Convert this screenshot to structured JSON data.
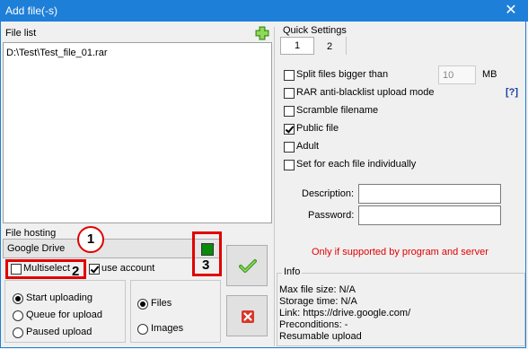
{
  "window": {
    "title": "Add file(-s)",
    "close_glyph": "✕"
  },
  "file_list": {
    "label": "File list",
    "add_icon": "plus-icon",
    "items": [
      "D:\\Test\\Test_file_01.rar"
    ]
  },
  "file_hosting": {
    "label": "File hosting",
    "selected": "Google Drive",
    "multiselect_label": "Multiselect",
    "multiselect_checked": false,
    "use_account_label": "use account",
    "use_account_checked": true,
    "status_color": "#0a8a0a"
  },
  "upload_mode": {
    "options": [
      "Start uploading",
      "Queue for upload",
      "Paused upload"
    ],
    "selected": 0
  },
  "content_type": {
    "options": [
      "Files",
      "Images"
    ],
    "selected": 0
  },
  "buttons": {
    "ok_icon": "check-icon",
    "cancel_icon": "x-icon"
  },
  "annotations": {
    "one": "1",
    "two": "2",
    "three": "3",
    "color": "#e00000"
  },
  "quick_settings": {
    "label": "Quick Settings",
    "tabs": [
      "1",
      "2"
    ],
    "active_tab": 0,
    "split_label": "Split files bigger than",
    "split_checked": false,
    "split_value": "10",
    "split_unit": "MB",
    "rar_label": "RAR anti-blacklist upload mode",
    "rar_checked": false,
    "help_link": "[?]",
    "scramble_label": "Scramble filename",
    "scramble_checked": false,
    "public_label": "Public file",
    "public_checked": true,
    "adult_label": "Adult",
    "adult_checked": false,
    "each_label": "Set for each file individually",
    "each_checked": false,
    "description_label": "Description:",
    "description_value": "",
    "password_label": "Password:",
    "password_value": "",
    "note": "Only if supported by program and server",
    "note_color": "#e00000"
  },
  "info": {
    "label": "Info",
    "lines": [
      "Max file size: N/A",
      "Storage time: N/A",
      "Link: https://drive.google.com/",
      "Preconditions: -",
      "Resumable upload"
    ]
  }
}
